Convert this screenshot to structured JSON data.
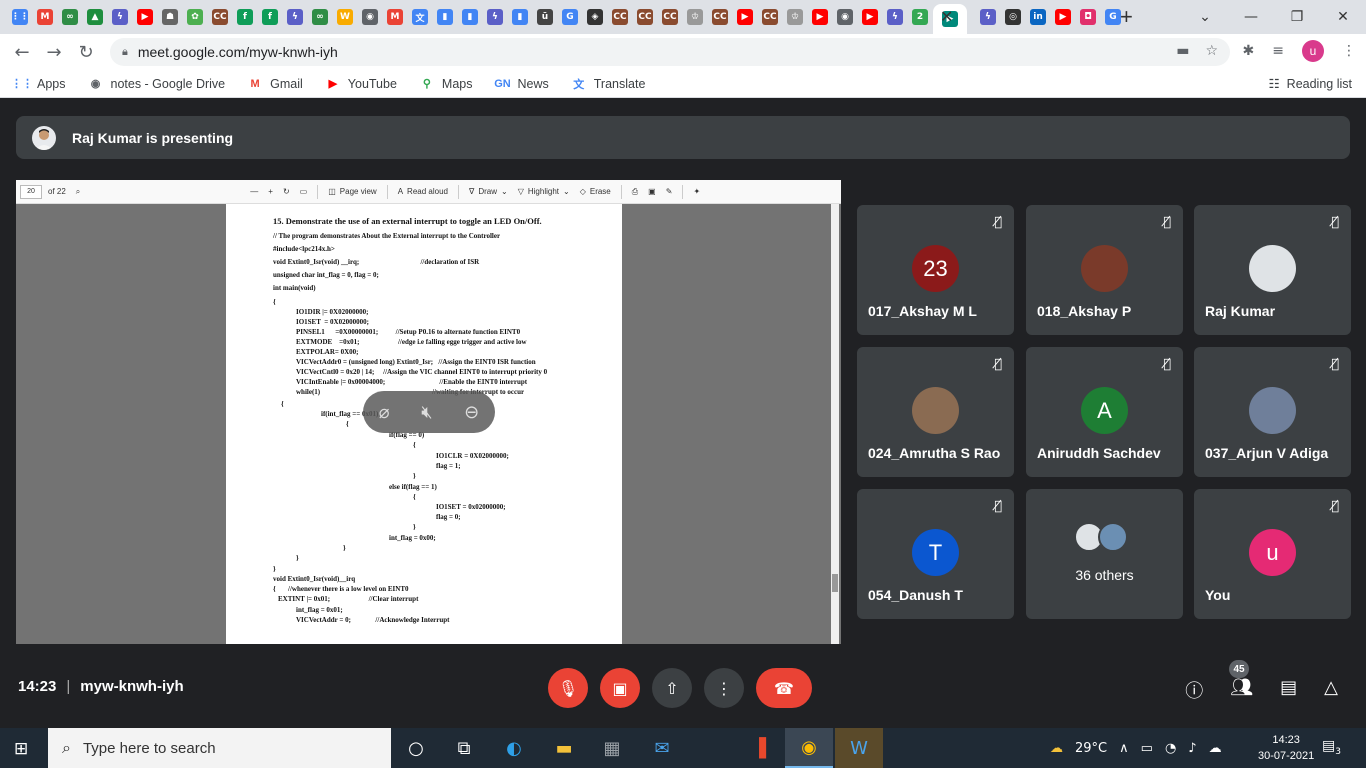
{
  "browser": {
    "tabs": [
      {
        "icon": "apps-grid-icon",
        "glyph": "⋮⋮",
        "color": "#4285f4"
      },
      {
        "icon": "gmail-icon",
        "glyph": "M",
        "color": "#ea4335"
      },
      {
        "icon": "geeksforgeeks-icon",
        "glyph": "∞",
        "color": "#2f8d46"
      },
      {
        "icon": "drive-icon",
        "glyph": "▲",
        "color": "#1e8e3e"
      },
      {
        "icon": "bolt-icon",
        "glyph": "ϟ",
        "color": "#5b5fc7"
      },
      {
        "icon": "youtube-icon",
        "glyph": "▶",
        "color": "#ff0000"
      },
      {
        "icon": "incognito-icon",
        "glyph": "☗",
        "color": "#666666"
      },
      {
        "icon": "photos-icon",
        "glyph": "✿",
        "color": "#4caf50"
      },
      {
        "icon": "cc-icon",
        "glyph": "CC",
        "color": "#8a4b2f"
      },
      {
        "icon": "f-icon",
        "glyph": "f",
        "color": "#0f9d58"
      },
      {
        "icon": "f-icon",
        "glyph": "f",
        "color": "#0f9d58"
      },
      {
        "icon": "bolt-icon",
        "glyph": "ϟ",
        "color": "#5b5fc7"
      },
      {
        "icon": "geeksforgeeks-icon",
        "glyph": "∞",
        "color": "#2f8d46"
      },
      {
        "icon": "w-icon",
        "glyph": "W",
        "color": "#f9ab00"
      },
      {
        "icon": "globe-icon",
        "glyph": "◉",
        "color": "#5f6368"
      },
      {
        "icon": "gmail-icon",
        "glyph": "M",
        "color": "#ea4335"
      },
      {
        "icon": "translate-icon",
        "glyph": "文",
        "color": "#4285f4"
      },
      {
        "icon": "chart-icon",
        "glyph": "▮",
        "color": "#4285f4"
      },
      {
        "icon": "chart-icon",
        "glyph": "▮",
        "color": "#4285f4"
      },
      {
        "icon": "bolt-icon",
        "glyph": "ϟ",
        "color": "#5b5fc7"
      },
      {
        "icon": "chart-icon",
        "glyph": "▮",
        "color": "#4285f4"
      },
      {
        "icon": "u-icon",
        "glyph": "ū",
        "color": "#444444"
      },
      {
        "icon": "google-icon",
        "glyph": "G",
        "color": "#4285f4"
      },
      {
        "icon": "shield-icon",
        "glyph": "◈",
        "color": "#333333"
      },
      {
        "icon": "cc-icon",
        "glyph": "CC",
        "color": "#8a4b2f"
      },
      {
        "icon": "cc-icon",
        "glyph": "CC",
        "color": "#8a4b2f"
      },
      {
        "icon": "cc-icon",
        "glyph": "CC",
        "color": "#8a4b2f"
      },
      {
        "icon": "chef-icon",
        "glyph": "♔",
        "color": "#999999"
      },
      {
        "icon": "cc-icon",
        "glyph": "CC",
        "color": "#8a4b2f"
      },
      {
        "icon": "youtube-icon",
        "glyph": "▶",
        "color": "#ff0000"
      },
      {
        "icon": "cc-icon",
        "glyph": "CC",
        "color": "#8a4b2f"
      },
      {
        "icon": "chef-icon",
        "glyph": "♔",
        "color": "#999999"
      },
      {
        "icon": "youtube-icon",
        "glyph": "▶",
        "color": "#ff0000"
      },
      {
        "icon": "globe-icon",
        "glyph": "◉",
        "color": "#5f6368"
      },
      {
        "icon": "youtube-icon",
        "glyph": "▶",
        "color": "#ff0000"
      },
      {
        "icon": "bolt-icon",
        "glyph": "ϟ",
        "color": "#5b5fc7"
      },
      {
        "icon": "badge-2-icon",
        "glyph": "2",
        "color": "#34a853"
      },
      {
        "icon": "meet-icon",
        "glyph": "▶",
        "color": "#00897b"
      }
    ],
    "tabs_after": [
      {
        "icon": "bolt-icon",
        "glyph": "ϟ",
        "color": "#5b5fc7"
      },
      {
        "icon": "github-icon",
        "glyph": "◎",
        "color": "#333333"
      },
      {
        "icon": "linkedin-icon",
        "glyph": "in",
        "color": "#0a66c2"
      },
      {
        "icon": "youtube-icon",
        "glyph": "▶",
        "color": "#ff0000"
      },
      {
        "icon": "instagram-icon",
        "glyph": "◘",
        "color": "#e1306c"
      },
      {
        "icon": "google-icon",
        "glyph": "G",
        "color": "#4285f4"
      }
    ],
    "url": "meet.google.com/myw-knwh-iyh",
    "profile_initial": "u",
    "bookmarks": [
      {
        "label": "Apps",
        "icon": "apps-grid-icon",
        "glyph": "⋮⋮",
        "color": "#4285f4"
      },
      {
        "label": "notes - Google Drive",
        "icon": "globe-icon",
        "glyph": "◉",
        "color": "#5f6368"
      },
      {
        "label": "Gmail",
        "icon": "gmail-icon",
        "glyph": "M",
        "color": "#ea4335"
      },
      {
        "label": "YouTube",
        "icon": "youtube-icon",
        "glyph": "▶",
        "color": "#ff0000"
      },
      {
        "label": "Maps",
        "icon": "maps-pin-icon",
        "glyph": "⚲",
        "color": "#34a853"
      },
      {
        "label": "News",
        "icon": "news-icon",
        "glyph": "GN",
        "color": "#4285f4"
      },
      {
        "label": "Translate",
        "icon": "translate-icon",
        "glyph": "文",
        "color": "#4285f4"
      }
    ],
    "reading_list": "Reading list"
  },
  "meet": {
    "presenter_text": "Raj Kumar is presenting",
    "pdf": {
      "page": "20",
      "of_pages": "of 22",
      "page_view": "Page view",
      "read_aloud": "Read aloud",
      "draw": "Draw",
      "highlight": "Highlight",
      "erase": "Erase",
      "lines": [
        "15. Demonstrate the use of an external interrupt to toggle an LED On/Off.",
        "// The program demonstrates About the External interrupt to the Controller",
        "#include<lpc214x.h>",
        "void Extint0_Isr(void) __irq;                                   //declaration of ISR",
        "unsigned char int_flag = 0, flag = 0;",
        "int main(void)",
        "{",
        "IO1DIR |= 0X02000000;",
        "IO1SET  = 0X02000000;",
        "PINSEL1      =0X00000001;          //Setup P0.16 to alternate function EINT0",
        "EXTMODE    =0x01;                      //edge i.e falling egge trigger and active low",
        "EXTPOLAR= 0X00;",
        "VICVectAddr0 = (unsigned long) Extint0_Isr;   //Assign the EINT0 ISR function",
        "VICVectCntl0 = 0x20 | 14;     //Assign the VIC channel EINT0 to interrupt priority 0",
        "VICIntEnable |= 0x00004000;                               //Enable the EINT0 interrupt",
        "while(1)                                                                //waiting for interrupt to occur",
        "{",
        "if(int_flag == 0x01)",
        "{",
        "if(flag == 0)",
        "{",
        "IO1CLR = 0X02000000;",
        "flag = 1;",
        "}",
        "else if(flag == 1)",
        "{",
        "IO1SET = 0x02000000;",
        "flag = 0;",
        "}",
        "int_flag = 0x00;",
        "}",
        "}",
        "}",
        "void Extint0_Isr(void)__irq",
        "{       //whenever there is a low level on EINT0",
        "EXTINT |= 0x01;                      //Clear interrupt",
        "int_flag = 0x01;",
        "VICVectAddr = 0;              //Acknowledge Interrupt"
      ]
    },
    "participants": [
      {
        "name": "017_Akshay M L",
        "initial": "23",
        "color": "#8b1a1a"
      },
      {
        "name": "018_Akshay P",
        "initial": "",
        "color": "#7a3a2a"
      },
      {
        "name": "Raj Kumar",
        "initial": "",
        "color": "#dfe3e6"
      },
      {
        "name": "024_Amrutha S Rao",
        "initial": "",
        "color": "#8a6b52"
      },
      {
        "name": "Aniruddh Sachdev",
        "initial": "A",
        "color": "#1e7e34"
      },
      {
        "name": "037_Arjun V Adiga",
        "initial": "",
        "color": "#6f7f9a"
      },
      {
        "name": "054_Danush T",
        "initial": "T",
        "color": "#0b57d0"
      },
      {
        "name": "You",
        "initial": "u",
        "color": "#e52a74"
      }
    ],
    "others_label": "36 others",
    "time": "14:23",
    "meeting_code": "myw-knwh-iyh",
    "people_count": "45"
  },
  "taskbar": {
    "search_placeholder": "Type here to search",
    "temperature": "29°C",
    "time": "14:23",
    "date": "30-07-2021",
    "notifications": "3"
  }
}
